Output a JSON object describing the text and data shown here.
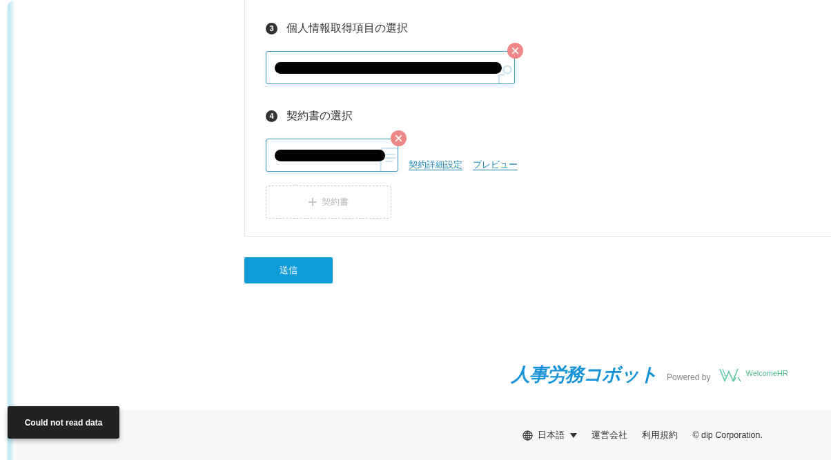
{
  "steps": [
    {
      "number": "3",
      "title": "個人情報取得項目の選択",
      "selections": [
        {
          "kind": "person",
          "redacted": true
        }
      ]
    },
    {
      "number": "4",
      "title": "契約書の選択",
      "selections": [
        {
          "kind": "document",
          "redacted": true,
          "links": [
            "契約詳細設定",
            "プレビュー"
          ]
        }
      ],
      "add_button": "契約書"
    }
  ],
  "submit_button": "送信",
  "branding": {
    "product_logo": "人事労務コボット",
    "powered_by": "Powered by",
    "partner_logo": "WelcomeHR"
  },
  "footer": {
    "language": "日本語",
    "links": [
      "運営会社",
      "利用規約"
    ],
    "copyright": "© dip Corporation."
  },
  "toast": {
    "message": "Could not read data"
  }
}
